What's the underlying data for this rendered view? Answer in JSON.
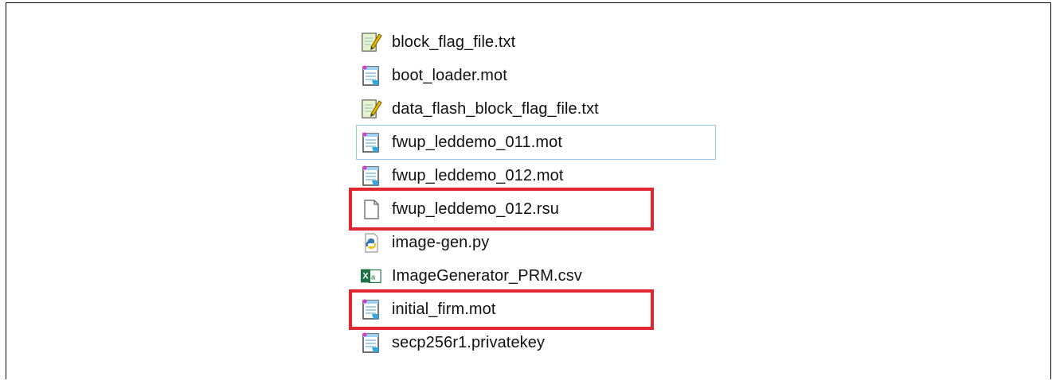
{
  "files": [
    {
      "name": "block_flag_file.txt",
      "icon": "text-file-icon"
    },
    {
      "name": "boot_loader.mot",
      "icon": "notepad-file-icon"
    },
    {
      "name": "data_flash_block_flag_file.txt",
      "icon": "text-file-icon"
    },
    {
      "name": "fwup_leddemo_011.mot",
      "icon": "notepad-file-icon",
      "selected": true
    },
    {
      "name": "fwup_leddemo_012.mot",
      "icon": "notepad-file-icon"
    },
    {
      "name": "fwup_leddemo_012.rsu",
      "icon": "blank-file-icon",
      "highlighted": true
    },
    {
      "name": "image-gen.py",
      "icon": "python-file-icon"
    },
    {
      "name": "ImageGenerator_PRM.csv",
      "icon": "excel-file-icon"
    },
    {
      "name": "initial_firm.mot",
      "icon": "notepad-file-icon",
      "highlighted": true
    },
    {
      "name": "secp256r1.privatekey",
      "icon": "notepad-file-icon"
    }
  ],
  "colors": {
    "highlight": "#e0262f",
    "selection": "#99c8f0"
  }
}
